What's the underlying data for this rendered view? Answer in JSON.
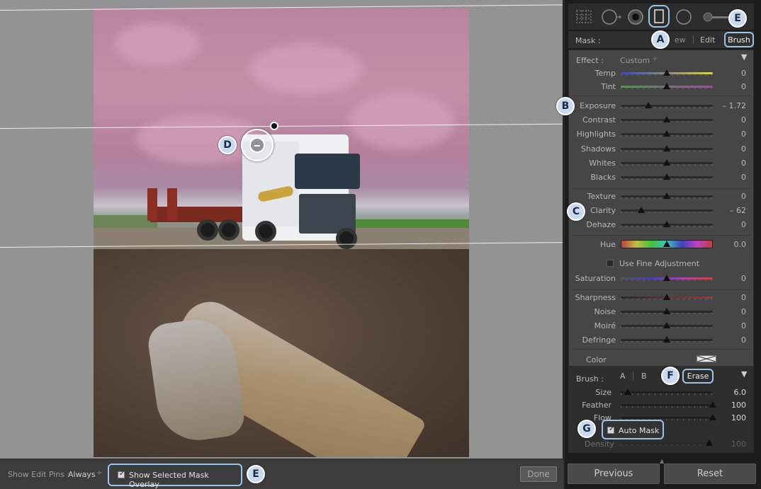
{
  "toolbar": {
    "show_pins_label": "Show Edit Pins :",
    "show_pins_value": "Always",
    "show_pins_caret": "÷",
    "overlay_label": "Show Selected Mask Overlay",
    "done_label": "Done"
  },
  "mask": {
    "label": "Mask :",
    "new_label": "ew",
    "edit_label": "Edit",
    "brush_label": "Brush"
  },
  "effect": {
    "label": "Effect :",
    "value": "Custom",
    "caret": "÷",
    "collapse": "▼"
  },
  "sliders": [
    {
      "label": "Temp",
      "value": "0",
      "pos": 0.5
    },
    {
      "label": "Tint",
      "value": "0",
      "pos": 0.5
    },
    {
      "label": "Exposure",
      "value": "– 1.72",
      "pos": 0.3
    },
    {
      "label": "Contrast",
      "value": "0",
      "pos": 0.5
    },
    {
      "label": "Highlights",
      "value": "0",
      "pos": 0.5
    },
    {
      "label": "Shadows",
      "value": "0",
      "pos": 0.5
    },
    {
      "label": "Whites",
      "value": "0",
      "pos": 0.5
    },
    {
      "label": "Blacks",
      "value": "0",
      "pos": 0.5
    },
    {
      "label": "Texture",
      "value": "0",
      "pos": 0.5
    },
    {
      "label": "Clarity",
      "value": "– 62",
      "pos": 0.22
    },
    {
      "label": "Dehaze",
      "value": "0",
      "pos": 0.5
    },
    {
      "label": "Hue",
      "value": "0.0",
      "pos": 0.5
    },
    {
      "label": "Saturation",
      "value": "0",
      "pos": 0.5
    },
    {
      "label": "Sharpness",
      "value": "0",
      "pos": 0.5
    },
    {
      "label": "Noise",
      "value": "0",
      "pos": 0.5
    },
    {
      "label": "Moiré",
      "value": "0",
      "pos": 0.5
    },
    {
      "label": "Defringe",
      "value": "0",
      "pos": 0.5
    }
  ],
  "fine_adjustment": "Use Fine Adjustment",
  "color_label": "Color",
  "brush": {
    "label": "Brush :",
    "a_label": "A",
    "b_label": "B",
    "erase_label": "Erase",
    "collapse": "▼",
    "sliders": [
      {
        "label": "Size",
        "value": "6.0",
        "pos": 0.08
      },
      {
        "label": "Feather",
        "value": "100",
        "pos": 1.0
      },
      {
        "label": "Flow",
        "value": "100",
        "pos": 1.0
      }
    ],
    "auto_mask_label": "Auto Mask",
    "density_label": "Density",
    "density_value": "100"
  },
  "footer": {
    "previous_label": "Previous",
    "reset_label": "Reset"
  },
  "callouts": {
    "a": "A",
    "b": "B",
    "c": "C",
    "d": "D",
    "e_top": "E",
    "e_bottom": "E",
    "f": "F",
    "g": "G"
  },
  "colors": {
    "callout_fill": "#c9d9ef",
    "highlight_border": "#9cc4ea",
    "mask_overlay": "#c490a8"
  },
  "icons": {
    "check": "✓"
  }
}
